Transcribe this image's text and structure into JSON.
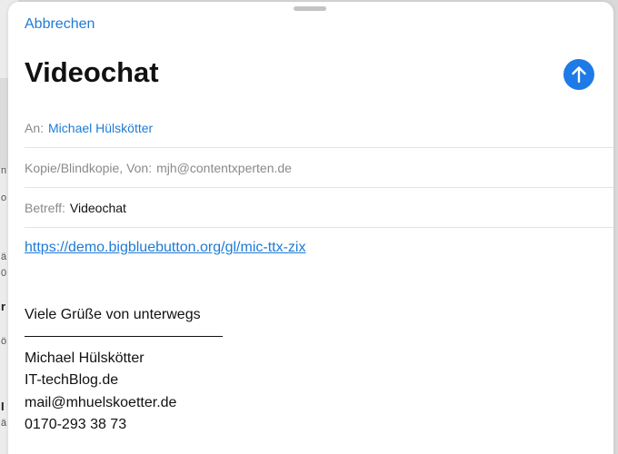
{
  "background": {
    "letters": [
      "n",
      "o",
      "ä",
      "0",
      "r",
      "ö",
      "I",
      "ä"
    ]
  },
  "compose": {
    "cancel_label": "Abbrechen",
    "title": "Videochat",
    "send_icon": "arrow-up-icon",
    "to": {
      "label": "An:",
      "recipient": "Michael Hülskötter"
    },
    "cc": {
      "label": "Kopie/Blindkopie, Von:",
      "value": "mjh@contentxperten.de"
    },
    "subject": {
      "label": "Betreff:",
      "value": "Videochat"
    },
    "body": {
      "link": "https://demo.bigbluebutton.org/gl/mic-ttx-zix",
      "greeting": "Viele Grüße von unterwegs",
      "signature": [
        "Michael Hülskötter",
        "IT-techBlog.de",
        "mail@mhuelskoetter.de",
        "0170-293 38 73"
      ]
    }
  },
  "colors": {
    "accent": "#1d7ae6",
    "link": "#1e7bd6"
  }
}
